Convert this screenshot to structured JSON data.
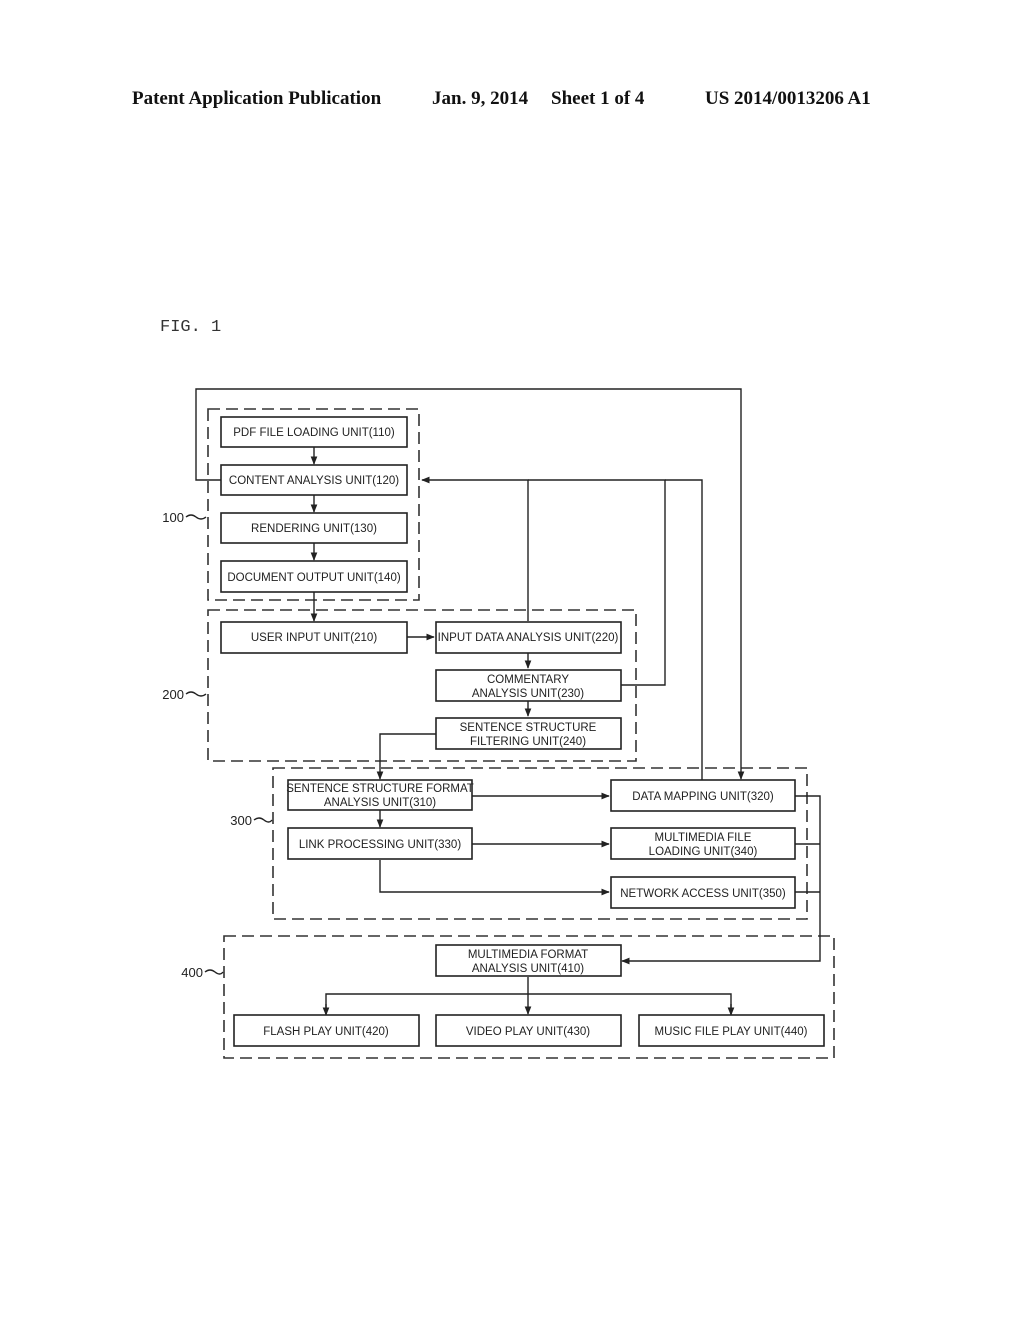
{
  "header": {
    "publication": "Patent Application Publication",
    "date": "Jan. 9, 2014",
    "sheet": "Sheet 1 of 4",
    "number": "US 2014/0013206 A1"
  },
  "figure": {
    "label": "FIG. 1"
  },
  "groups": [
    {
      "id": "g100",
      "ref": "100"
    },
    {
      "id": "g200",
      "ref": "200"
    },
    {
      "id": "g300",
      "ref": "300"
    },
    {
      "id": "g400",
      "ref": "400"
    }
  ],
  "units": {
    "u110": [
      "PDF FILE LOADING UNIT(110)"
    ],
    "u120": [
      "CONTENT ANALYSIS UNIT(120)"
    ],
    "u130": [
      "RENDERING UNIT(130)"
    ],
    "u140": [
      "DOCUMENT OUTPUT UNIT(140)"
    ],
    "u210": [
      "USER INPUT UNIT(210)"
    ],
    "u220": [
      "INPUT DATA ANALYSIS UNIT(220)"
    ],
    "u230": [
      "COMMENTARY",
      "ANALYSIS UNIT(230)"
    ],
    "u240": [
      "SENTENCE STRUCTURE",
      "FILTERING UNIT(240)"
    ],
    "u310": [
      "SENTENCE STRUCTURE FORMAT",
      "ANALYSIS UNIT(310)"
    ],
    "u320": [
      "DATA MAPPING UNIT(320)"
    ],
    "u330": [
      "LINK PROCESSING UNIT(330)"
    ],
    "u340": [
      "MULTIMEDIA FILE",
      "LOADING UNIT(340)"
    ],
    "u350": [
      "NETWORK ACCESS UNIT(350)"
    ],
    "u410": [
      "MULTIMEDIA FORMAT",
      "ANALYSIS UNIT(410)"
    ],
    "u420": [
      "FLASH PLAY UNIT(420)"
    ],
    "u430": [
      "VIDEO PLAY UNIT(430)"
    ],
    "u440": [
      "MUSIC FILE PLAY UNIT(440)"
    ]
  }
}
